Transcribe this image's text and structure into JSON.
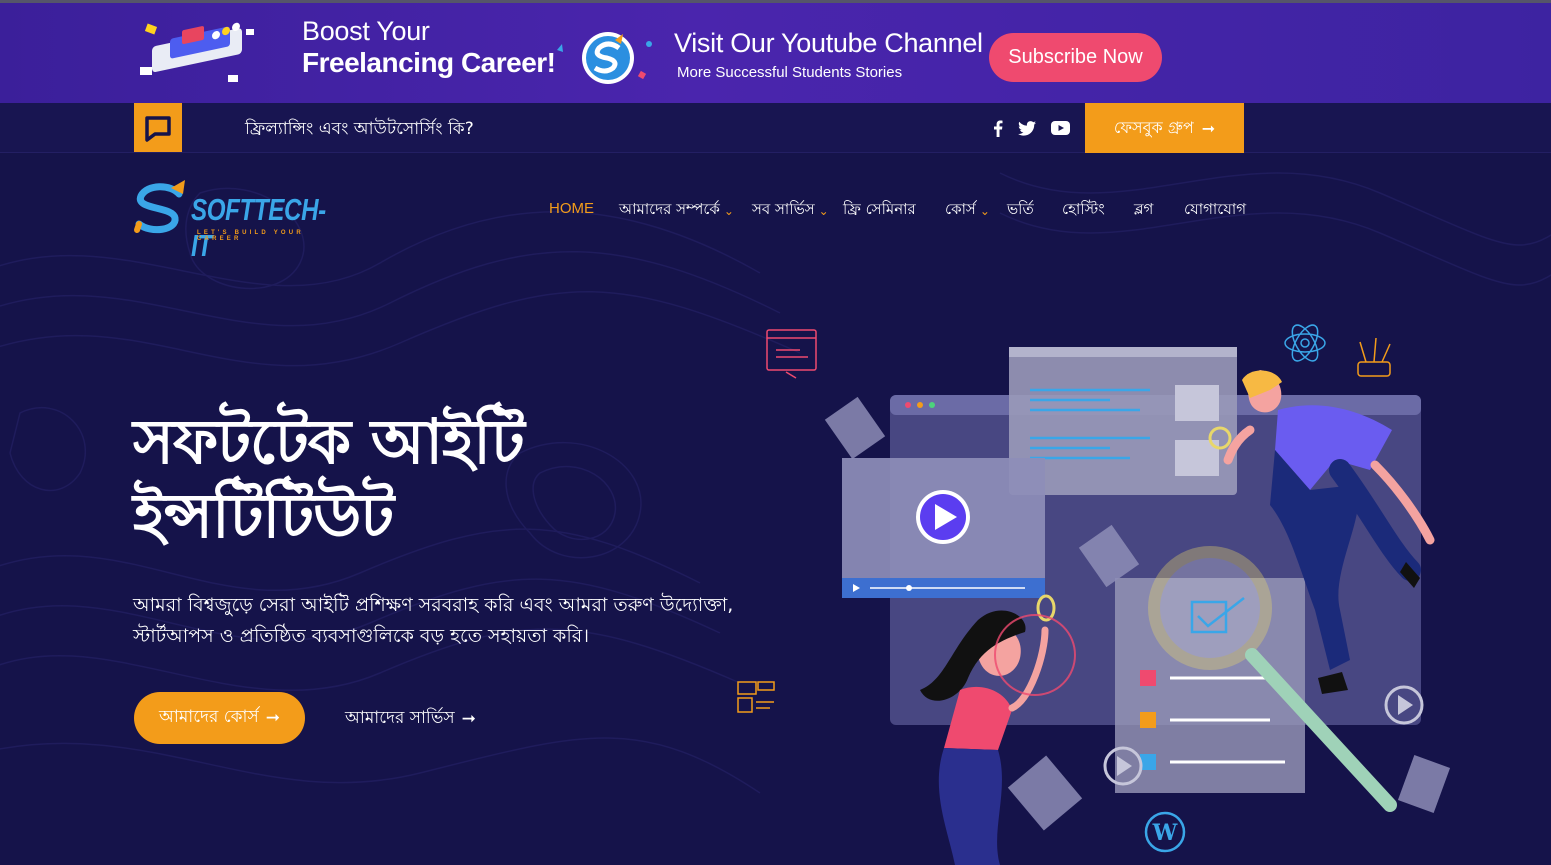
{
  "promo": {
    "boost_line1": "Boost Your",
    "boost_line2": "Freelancing Career!",
    "youtube_title": "Visit Our Youtube Channel",
    "youtube_sub": "More Successful Students Stories",
    "subscribe_label": "Subscribe Now"
  },
  "topbar": {
    "link_text": "ফ্রিল্যান্সিং এবং আউটসোর্সিং কি?",
    "fb_group_label": "ফেসবুক গ্রুপ",
    "social_icons": [
      "facebook-icon",
      "twitter-icon",
      "youtube-icon"
    ]
  },
  "logo": {
    "brand": "SOFTTECH-IT",
    "tagline": "LET'S BUILD YOUR CAREER"
  },
  "nav": {
    "items": [
      {
        "label": "HOME",
        "active": true,
        "dropdown": false
      },
      {
        "label": "আমাদের সম্পর্কে",
        "active": false,
        "dropdown": true
      },
      {
        "label": "সব সার্ভিস",
        "active": false,
        "dropdown": true
      },
      {
        "label": "ফ্রি সেমিনার",
        "active": false,
        "dropdown": false
      },
      {
        "label": "কোর্স",
        "active": false,
        "dropdown": true
      },
      {
        "label": "ভর্তি",
        "active": false,
        "dropdown": false
      },
      {
        "label": "হোস্টিং",
        "active": false,
        "dropdown": false
      },
      {
        "label": "ব্লগ",
        "active": false,
        "dropdown": false
      },
      {
        "label": "যোগাযোগ",
        "active": false,
        "dropdown": false
      }
    ]
  },
  "hero": {
    "title_line1": "সফটটেক আইটি",
    "title_line2": "ইন্সটিটিউট",
    "description": "আমরা বিশ্বজুড়ে সেরা আইটি প্রশিক্ষণ সরবরাহ করি এবং আমরা তরুণ উদ্যোক্তা, স্টার্টআপস ও প্রতিষ্ঠিত ব্যবসাগুলিকে বড় হতে সহায়তা করি।",
    "primary_button": "আমাদের কোর্স",
    "secondary_button": "আমাদের সার্ভিস"
  },
  "colors": {
    "accent": "#f39c1a",
    "subscribe": "#ef4a6f",
    "background": "#15134a",
    "promo": "#4a25ad",
    "brand_blue": "#3aa6e8"
  }
}
